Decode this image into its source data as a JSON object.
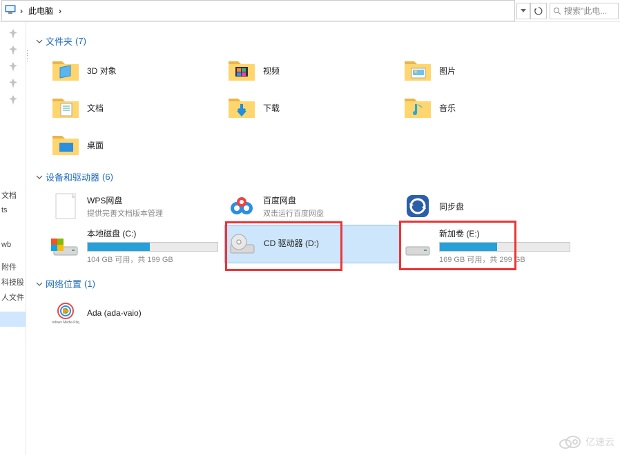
{
  "addressbar": {
    "location": "此电脑",
    "search_placeholder": "搜索\"此电...",
    "chevron": "›"
  },
  "sidebar": {
    "labels": [
      "文档",
      "ts",
      "wb",
      "附件",
      "科技股",
      "人文件"
    ]
  },
  "groups": {
    "folders": {
      "title": "文件夹",
      "count": "(7)"
    },
    "drives": {
      "title": "设备和驱动器",
      "count": "(6)"
    },
    "network": {
      "title": "网络位置",
      "count": "(1)"
    }
  },
  "folders": [
    {
      "name": "3D 对象"
    },
    {
      "name": "视频"
    },
    {
      "name": "图片"
    },
    {
      "name": "文档"
    },
    {
      "name": "下载"
    },
    {
      "name": "音乐"
    },
    {
      "name": "桌面"
    }
  ],
  "drives": [
    {
      "name": "WPS网盘",
      "sub": "提供完善文档版本管理",
      "type": "cloud"
    },
    {
      "name": "百度网盘",
      "sub": "双击运行百度网盘",
      "type": "cloud2"
    },
    {
      "name": "同步盘",
      "sub": "",
      "type": "sync"
    },
    {
      "name": "本地磁盘 (C:)",
      "info": "104 GB 可用，共 199 GB",
      "fill": 48,
      "type": "disk",
      "os": true
    },
    {
      "name": "CD 驱动器 (D:)",
      "info": "",
      "fill": 0,
      "type": "cd",
      "selected": true
    },
    {
      "name": "新加卷 (E:)",
      "info": "169 GB 可用，共 299 GB",
      "fill": 44,
      "type": "disk"
    }
  ],
  "network": [
    {
      "name": "Ada (ada-vaio)"
    }
  ],
  "watermark": "亿速云"
}
